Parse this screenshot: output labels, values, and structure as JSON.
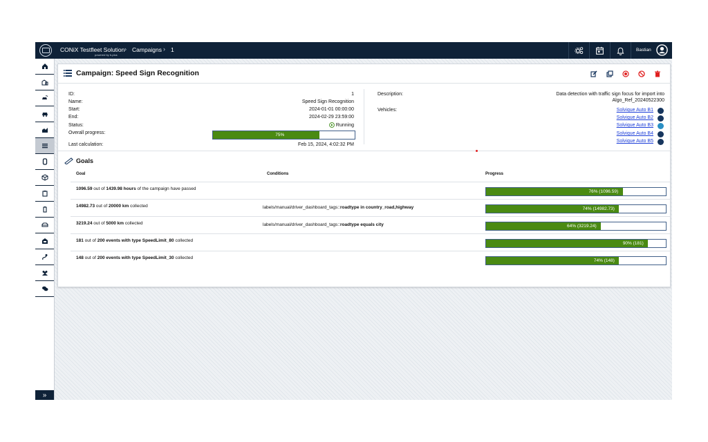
{
  "app": {
    "title": "CONiX Testfleet Solution",
    "powered_by": "powered by b-plus"
  },
  "breadcrumb": {
    "items": [
      "Campaigns",
      "1"
    ],
    "separator": "›"
  },
  "user": {
    "name": "Bastian"
  },
  "topbar_icons": [
    "settings-icon",
    "calendar-icon",
    "bell-icon"
  ],
  "sidebar": {
    "items": [
      "home-icon",
      "buildings-icon",
      "car-signal-icon",
      "car-icon",
      "chart-icon",
      "list-icon",
      "device-icon",
      "package-icon",
      "clipboard-icon",
      "battery-icon",
      "vehicle-icon",
      "garage-icon",
      "route-icon",
      "users-icon",
      "chat-icon"
    ],
    "expand": "»"
  },
  "campaign": {
    "title": "Campaign: Speed Sign Recognition",
    "actions": [
      "edit-icon",
      "copy-icon",
      "record-icon",
      "cancel-icon",
      "delete-icon"
    ],
    "fields": [
      {
        "label": "ID:",
        "value": "1"
      },
      {
        "label": "Name:",
        "value": "Speed Sign Recognition"
      },
      {
        "label": "Start:",
        "value": "2024-01-01 00:00:00"
      },
      {
        "label": "End:",
        "value": "2024-02-29 23:59:00"
      },
      {
        "label": "Status:",
        "value": "Running"
      },
      {
        "label": "Overall progress:",
        "value": "75%"
      },
      {
        "label": "Last calculation:",
        "value": "Feb 15, 2024, 4:02:32 PM"
      }
    ],
    "overall_progress": 0.75,
    "description_label": "Description:",
    "description_line1": "Data detection with traffic sign focus for import into",
    "description_line2": "Algo_Ref_20240522300",
    "vehicles_label": "Vehicles:",
    "vehicles": [
      {
        "name": "Solvique Auto B1",
        "color": "#17365e"
      },
      {
        "name": "Solvique Auto B2",
        "color": "#17365e"
      },
      {
        "name": "Solvique Auto B3",
        "color": "#2a8fc4"
      },
      {
        "name": "Solvique Auto B4",
        "color": "#17365e"
      },
      {
        "name": "Solvique Auto B5",
        "color": "#17365e"
      }
    ]
  },
  "goals": {
    "title": "Goals",
    "headers": {
      "goal": "Goal",
      "conditions": "Conditions",
      "progress": "Progress"
    },
    "rows": [
      {
        "v1": "1096.59",
        "t1": " out of ",
        "v2": "1439.98 hours",
        "t2": " of the campaign have passed",
        "cond_prefix": "",
        "cond_bold": "",
        "progress": 0.76,
        "label": "76% (1096.59)"
      },
      {
        "v1": "14982.73",
        "t1": " out of ",
        "v2": "20000 km",
        "t2": " collected",
        "cond_prefix": "labels/manual/driver_dashboard_tags::",
        "cond_bold": "roadtype in country_road,highway",
        "progress": 0.74,
        "label": "74% (14982.73)"
      },
      {
        "v1": "3219.24",
        "t1": " out of ",
        "v2": "5000 km",
        "t2": " collected",
        "cond_prefix": "labels/manual/driver_dashboard_tags::",
        "cond_bold": "roadtype equals city",
        "progress": 0.64,
        "label": "64% (3219.24)"
      },
      {
        "v1": "181",
        "t1": " out of ",
        "v2": "200 events with type SpeedLimit_80",
        "t2": " collected",
        "cond_prefix": "",
        "cond_bold": "",
        "progress": 0.9,
        "label": "90% (181)"
      },
      {
        "v1": "148",
        "t1": " out of ",
        "v2": "200 events with type SpeedLimit_30",
        "t2": " collected",
        "cond_prefix": "",
        "cond_bold": "",
        "progress": 0.74,
        "label": "74% (148)"
      }
    ]
  },
  "colors": {
    "topbar": "#0f2238",
    "progress_fill": "#4a8a12",
    "progress_border": "#3f5e88",
    "link": "#1a3cd8"
  }
}
